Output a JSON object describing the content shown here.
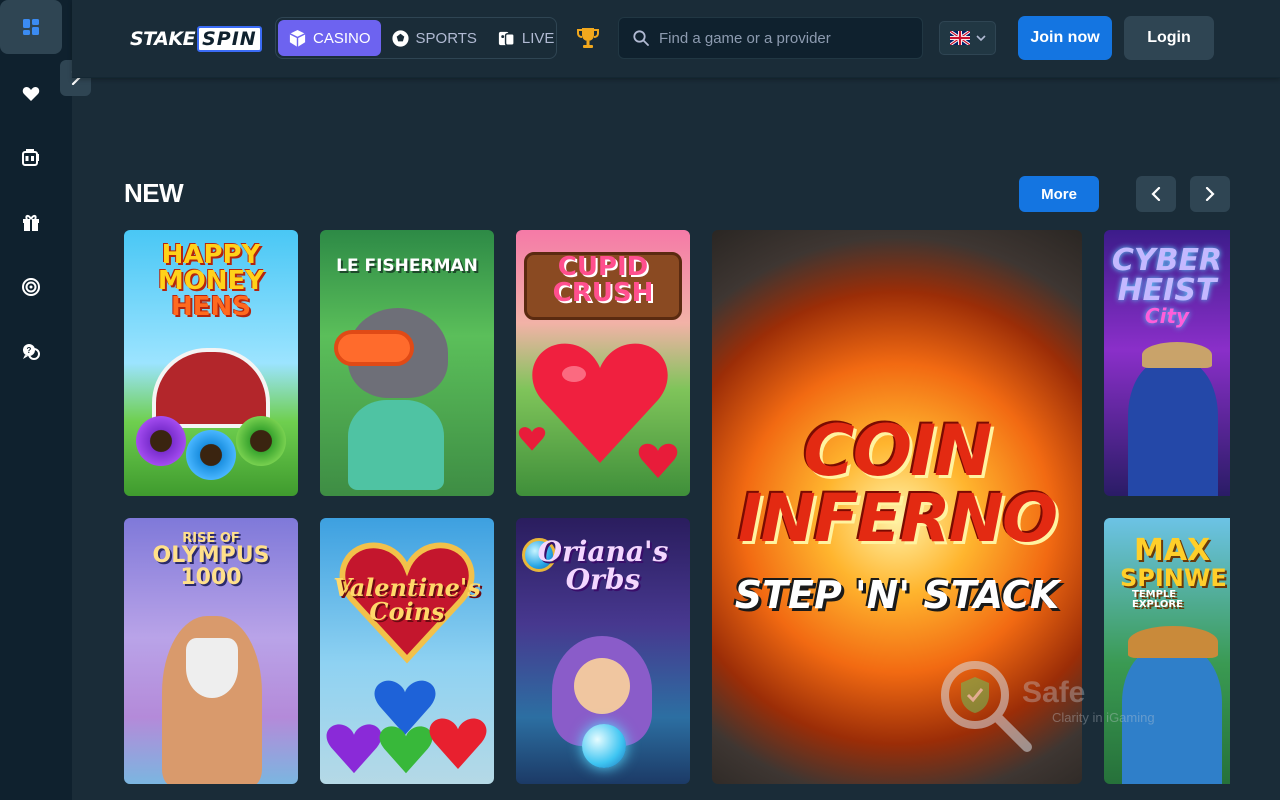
{
  "brand": {
    "logo_part1": "STAKE",
    "logo_part2": "SPIN"
  },
  "nav": {
    "tabs": [
      {
        "label": "CASINO",
        "icon": "dice-icon",
        "active": true
      },
      {
        "label": "SPORTS",
        "icon": "soccer-ball-icon",
        "active": false
      },
      {
        "label": "LIVE",
        "icon": "live-cards-icon",
        "active": false
      }
    ]
  },
  "search": {
    "placeholder": "Find a game or a provider",
    "value": ""
  },
  "language": {
    "flag": "uk-flag-icon"
  },
  "auth": {
    "join_label": "Join now",
    "login_label": "Login"
  },
  "sidebar": {
    "items": [
      {
        "icon": "grid-icon",
        "active": true
      },
      {
        "icon": "heart-icon"
      },
      {
        "icon": "slot-machine-icon"
      },
      {
        "icon": "gift-icon"
      },
      {
        "icon": "target-icon"
      },
      {
        "icon": "chat-support-icon"
      }
    ]
  },
  "section": {
    "title": "NEW",
    "more_label": "More"
  },
  "games": [
    {
      "title_line1": "HAPPY",
      "title_line2": "MONEY",
      "title_line3": "HENS"
    },
    {
      "title_line1": "LE FISHERMAN"
    },
    {
      "title_line1": "CUPID",
      "title_line2": "CRUSH"
    },
    {
      "title_line1": "COIN",
      "title_line2": "INFERNO",
      "title_line3": "STEP 'N' STACK"
    },
    {
      "title_line1": "CYBER",
      "title_line2": "HEIST",
      "title_line3": "City"
    },
    {
      "title_line1": "RISE OF",
      "title_line2": "OLYMPUS",
      "title_line3": "1000"
    },
    {
      "title_line1": "Valentine's",
      "title_line2": "Coins"
    },
    {
      "title_line1": "Oriana's",
      "title_line2": "Orbs"
    },
    {
      "title_line1": "MAX",
      "title_line2": "SPINWE",
      "title_line3": "TEMPLE EXPLORE"
    }
  ],
  "watermark": {
    "text": "Safe",
    "sub": "Clarity in iGaming"
  },
  "colors": {
    "accent": "#1475e1",
    "casino_tab": "#6d63f0",
    "bg": "#1a2c38",
    "sidebar": "#0f212e"
  }
}
